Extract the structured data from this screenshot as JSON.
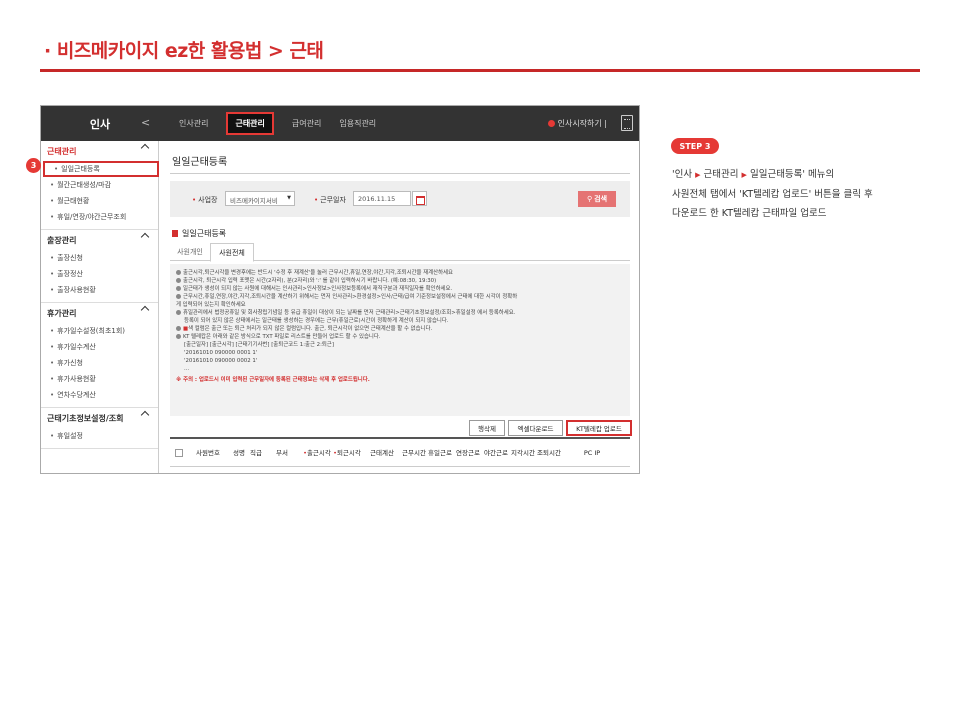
{
  "page": {
    "title": "· 비즈메카이지 ez한 활용법 > 근태"
  },
  "app": {
    "module": "인사",
    "back": "<",
    "top_menu": [
      "인사관리",
      "근태관리",
      "급여관리",
      "임용직관리"
    ],
    "top_right": "인사시작하기 |",
    "sidebar": {
      "groups": [
        {
          "title": "근태관리",
          "items": [
            "일일근태등록",
            "월간근태생성/마감",
            "월근태현황",
            "휴일/연장/야간근무조회"
          ]
        },
        {
          "title": "출장관리",
          "items": [
            "출장신청",
            "출장정산",
            "출장사용현황"
          ]
        },
        {
          "title": "휴가관리",
          "items": [
            "휴가일수설정(최초1회)",
            "휴가일수계산",
            "휴가신청",
            "휴가사용현황",
            "연차수당계산"
          ]
        },
        {
          "title": "근태기초정보설정/조회",
          "items": [
            "휴일설정"
          ]
        }
      ]
    },
    "content": {
      "title": "일일근태등록",
      "filter": {
        "company_label": "사업장",
        "company_value": "비즈메카이지서비",
        "date_label": "근무일자",
        "date_value": "2016.11.15",
        "search_label": "검색"
      },
      "section_title": "일일근태등록",
      "tabs": [
        "사원개인",
        "사원전체"
      ],
      "notes": [
        "출근시각,퇴근시각을 변경후에는 반드시 '수정 후 재계산'을 눌러 근무시간,휴일,연장,야간,지각,조퇴시간을 재계산하세요",
        "출근시각, 퇴근시각 입력 포맷은 시간(2자리), 분(2자리)와 ':' 를 같이 입력하시기 바랍니다. (예:08:30, 19:30)",
        "일근태가 생성이 되지 않는 사원에 대해서는 인사관리>인사정보>인사정보등록에서 재직구분과 재직일자를 확인하세요.",
        "근무시간,휴일,연장,야간,지각,조퇴시간을 계산하기 위해서는 먼저 인사관리>환경설정>인사/근태/급여 기준정보설정에서 근태에 대한 시각이 정확하",
        "게 입력되어 있는지 확인하세요",
        "휴일관리에서 법정공휴일 및 회사창립기념일 등 유급 휴일이 대상이 되는 날짜를 먼저 근태관리>근태기초정보설정/조회>휴일설정 에서 등록하세요.",
        "등록이 되어 있지 않은 상태에서는 일근태를 생성하는 경우에는 근무(휴일근로)시간이 정확하게 계산이 되지 않습니다.",
        "색 컬럼은 출근 또는 퇴근 처리가 되지 않은 컬럼입니다. 출근, 퇴근시각이 없으면 근태계산을 할 수 없습니다.",
        "KT 텔레캅은 아래와 같은 방식으로 TXT 파일로 리스트를 만들어 업로드 할 수 있습니다.",
        "[출근일자] [출근시각] [근태기기사번] [출퇴근코드 1:출근 2:퇴근]",
        "'20161010 090000 0001 1'",
        "'20161010 090000 0002 1'",
        "..."
      ],
      "warning": "※ 주의 : 업로드시 이미 입력된 근무일자에 등록된 근태정보는 삭제 후 업로드됩니다.",
      "buttons": [
        "행삭제",
        "엑셀다운로드",
        "KT텔레캅 업로드"
      ],
      "table_headers": [
        "사원번호",
        "성명",
        "직급",
        "부서",
        "출근시각",
        "퇴근시각",
        "근태계산",
        "근무시간",
        "휴일근로",
        "연장근로",
        "야간근로",
        "지각시간",
        "조퇴시간",
        "PC IP"
      ]
    }
  },
  "step": {
    "marker": "3",
    "badge": "STEP 3",
    "line1_a": "'인사",
    "line1_b": "근태관리",
    "line1_c": "일일근태등록' 메뉴의",
    "line2": "사원전체 탭에서 'KT텔레캅 업로드' 버튼을 클릭 후",
    "line3": "다운로드 한 KT텔레캅 근태파일 업로드"
  },
  "colors": {
    "accent": "#d32f2f",
    "topbar": "#333333"
  }
}
